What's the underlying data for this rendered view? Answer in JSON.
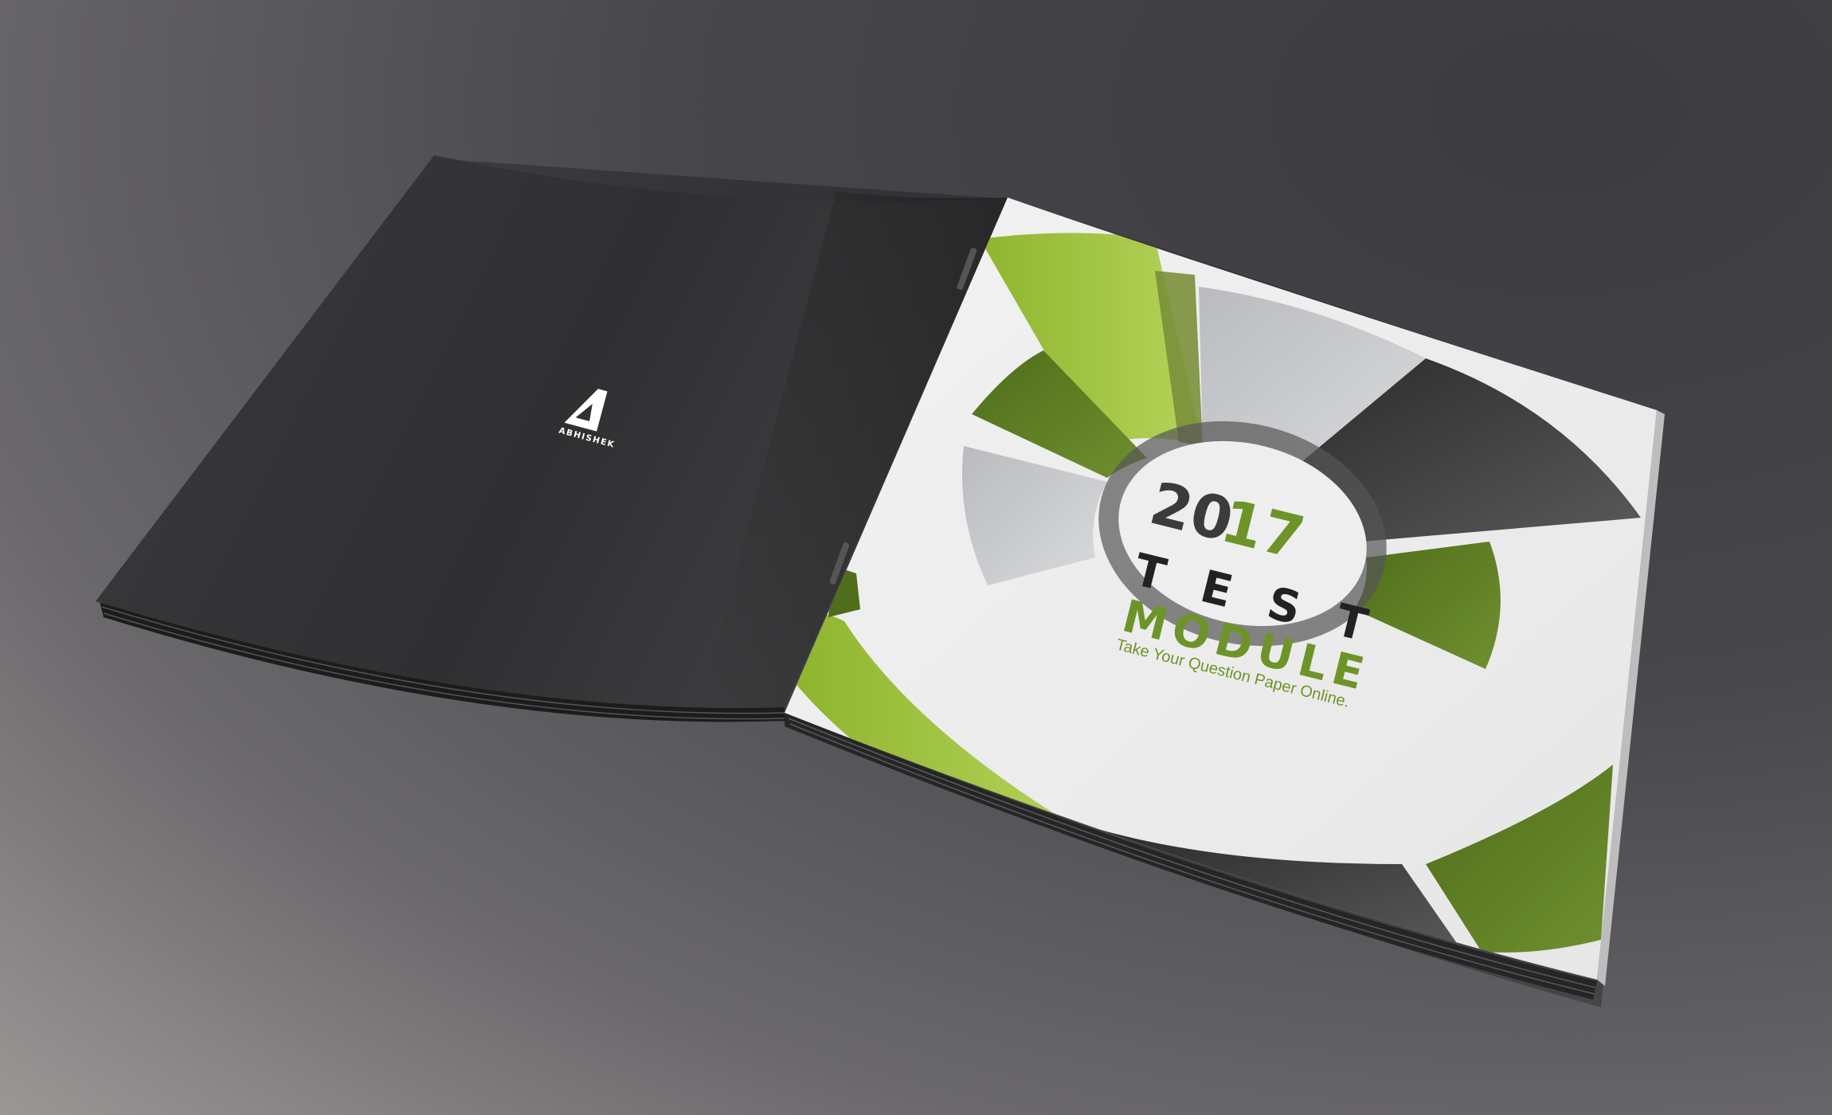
{
  "brochure": {
    "back_cover": {
      "logo_text": "ABHISHEK"
    },
    "front_cover": {
      "year_part1": "20",
      "year_part2": "17",
      "title_line1": "TEST",
      "title_line2": "MODULE",
      "tagline": "Take Your Question Paper Online."
    }
  },
  "colors": {
    "back_cover": "#2e2d2f",
    "green_dark": "#5b7a22",
    "green_light": "#a4c640",
    "gray_light": "#c4c6c9",
    "charcoal": "#3a3a3b",
    "year_dark": "#3b3b3b",
    "year_green": "#6d9428"
  }
}
